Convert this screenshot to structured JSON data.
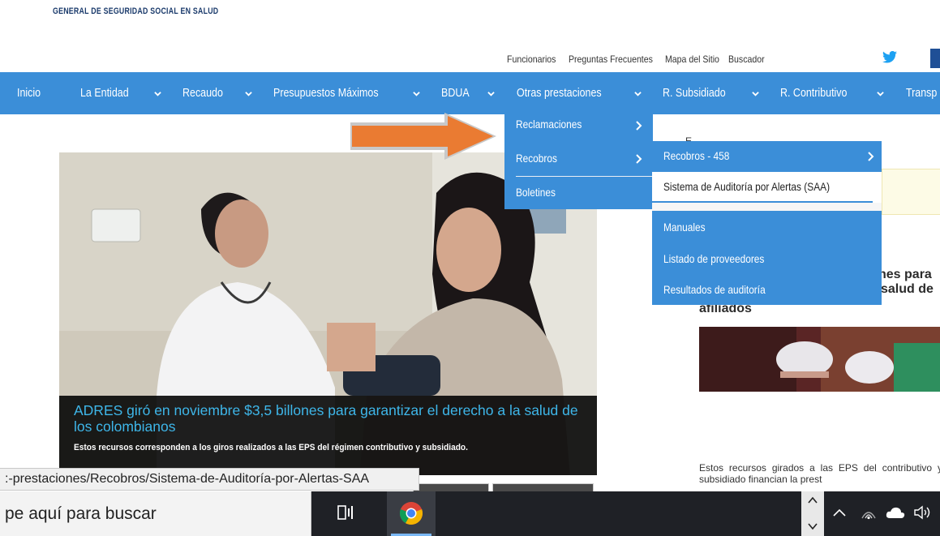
{
  "header": {
    "org_text": "GENERAL DE SEGURIDAD SOCIAL EN SALUD"
  },
  "utility_links": [
    "Funcionarios",
    "Preguntas Frecuentes",
    "Mapa del Sitio",
    "Buscador"
  ],
  "nav": {
    "items": [
      {
        "label": "Inicio"
      },
      {
        "label": "La Entidad"
      },
      {
        "label": "Recaudo"
      },
      {
        "label": "Presupuestos Máximos"
      },
      {
        "label": "BDUA"
      },
      {
        "label": "Otras prestaciones"
      },
      {
        "label": "R. Subsidiado"
      },
      {
        "label": "R. Contributivo"
      },
      {
        "label": "Transp"
      }
    ]
  },
  "dropdown_otras": {
    "items": [
      {
        "label": "Reclamaciones"
      },
      {
        "label": "Recobros"
      },
      {
        "label": "Boletines"
      }
    ]
  },
  "dropdown_recobros": {
    "items": [
      {
        "label": "Recobros - 458"
      },
      {
        "label": "Sistema de Auditoría por Alertas (SAA)"
      },
      {
        "label": "Manuales"
      },
      {
        "label": "Listado de proveedores"
      },
      {
        "label": "Resultados de auditoría"
      }
    ]
  },
  "hero": {
    "title": "ADRES giró en noviembre $3,5 billones para garantizar el derecho a la salud de los colombianos",
    "subtitle": "Estos recursos corresponden a los giros realizados a las EPS del régimen contributivo y subsidiado."
  },
  "right_column": {
    "peek_text": "E",
    "news_title_line1": "nes para",
    "news_title_line2": "salud de",
    "news_title_line3": "afiliados",
    "news_text": "Estos recursos girados a las EPS del contributivo y subsidiado financian la prest"
  },
  "status_url": ":-prestaciones/Recobros/Sistema-de-Auditoría-por-Alertas-SAA",
  "taskbar": {
    "search_placeholder": "pe aquí para buscar"
  },
  "colors": {
    "nav_blue": "#3b8ed8",
    "arrow_orange": "#ea7b32",
    "hero_title_blue": "#3eb6e9"
  }
}
